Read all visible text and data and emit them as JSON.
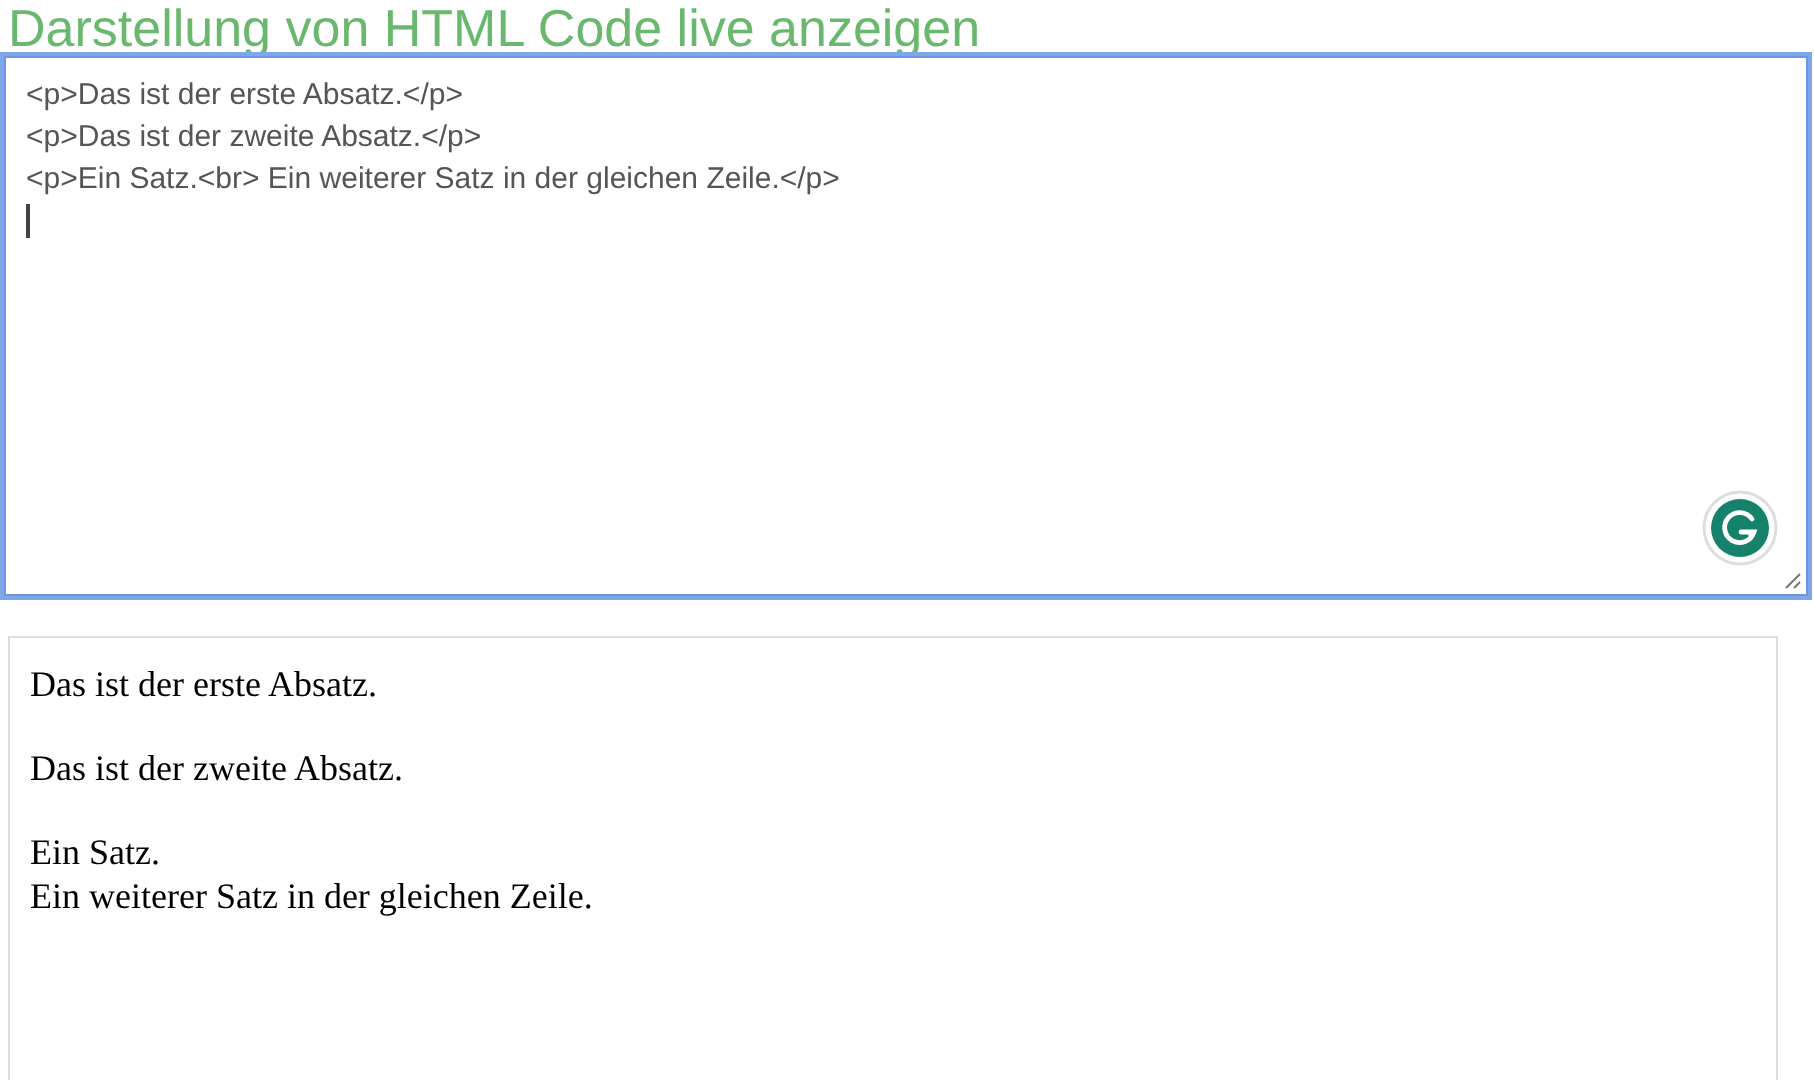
{
  "title": "Darstellung von HTML Code live anzeigen",
  "editor": {
    "lines": [
      "<p>Das ist der erste Absatz.</p>",
      "<p>Das ist der zweite Absatz.</p>",
      "<p>Ein Satz.<br> Ein weiterer Satz in der gleichen Zeile.</p>"
    ],
    "focused": true
  },
  "preview": {
    "paragraphs": [
      {
        "lines": [
          "Das ist der erste Absatz."
        ]
      },
      {
        "lines": [
          "Das ist der zweite Absatz."
        ]
      },
      {
        "lines": [
          "Ein Satz.",
          "Ein weiterer Satz in der gleichen Zeile."
        ]
      }
    ]
  }
}
